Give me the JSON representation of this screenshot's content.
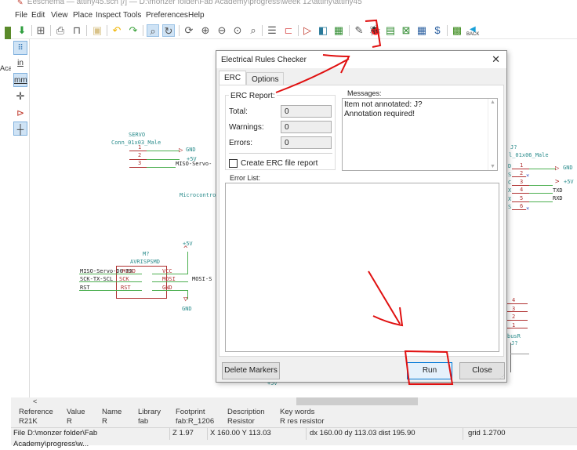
{
  "window": {
    "title": "Eeschema — attiny45.sch [/] — D:\\monzer folder\\Fab Academy\\progress\\week 12\\attiny\\attiny45"
  },
  "menu": [
    "File",
    "Edit",
    "View",
    "Place",
    "Inspect",
    "Tools",
    "Preferences",
    "Help"
  ],
  "toolbar": {
    "icons": [
      "save-icon",
      "page-settings-icon",
      "print-icon",
      "plot-icon",
      "paste-icon",
      "undo-icon",
      "redo-icon",
      "find-icon",
      "find-replace-icon",
      "redraw-icon",
      "zoom-in-icon",
      "zoom-out-icon",
      "zoom-fit-icon",
      "zoom-selection-icon",
      "hierarchy-navigator-icon",
      "leave-sheet-icon",
      "symbol-editor-icon",
      "symbol-browser-icon",
      "footprint-editor-icon",
      "annotate-icon",
      "erc-icon",
      "assign-footprints-icon",
      "netlist-icon",
      "bom-table-icon",
      "bom-icon",
      "pcbnew-icon",
      "back-icon"
    ],
    "back_label": "BACK"
  },
  "left_toolbar": {
    "items": [
      "grid-toggle",
      "units-inches",
      "units-mm",
      "cursor-shape",
      "hidden-pins",
      "wire-angle"
    ],
    "in_label": "in",
    "mm_label": "mm",
    "side_text": "Aca"
  },
  "schematic": {
    "servo": {
      "ref": "SERVO",
      "value": "Conn_01x03_Male",
      "pins": [
        "1",
        "2",
        "3"
      ],
      "nets": [
        "GND",
        "+5V",
        "MISO-Servo-"
      ]
    },
    "micro_label": "Microcontro",
    "isp": {
      "ref": "M?",
      "value": "AVRISPSMD",
      "left_pins": [
        "MISO",
        "SCK",
        "RST"
      ],
      "right_pins": [
        "VCC",
        "MOSI",
        "GND"
      ],
      "left_nets": [
        "MISO-Servo-D0-RX",
        "SCK-TX-SCL",
        "RST"
      ],
      "right_net": "MOSI-S",
      "power_top": "+5V",
      "power_bottom": "GND"
    },
    "ftdi": {
      "ref": "J?",
      "value": "l_01x06_Male",
      "pins": [
        "1",
        "2",
        "3",
        "4",
        "5",
        "6"
      ],
      "pin_names": [
        "D",
        "S",
        "C",
        "X",
        "X",
        "S"
      ],
      "nets": [
        "GND",
        "",
        "+5V",
        "TXD",
        "RXD",
        ""
      ]
    },
    "bus_r": {
      "pins": [
        "4",
        "3",
        "2",
        "1"
      ],
      "label": "busR",
      "ref": "J?"
    },
    "bottom_power": "+5V"
  },
  "dialog": {
    "title": "Electrical Rules Checker",
    "tabs": [
      "ERC",
      "Options"
    ],
    "active_tab": "ERC",
    "erc_report_label": "ERC Report:",
    "total_label": "Total:",
    "total_value": "0",
    "warnings_label": "Warnings:",
    "warnings_value": "0",
    "errors_label": "Errors:",
    "errors_value": "0",
    "create_report_label": "Create ERC file report",
    "create_report_checked": false,
    "messages_label": "Messages:",
    "messages": [
      "Item not annotated: J?",
      "Annotation required!"
    ],
    "error_list_label": "Error List:",
    "delete_markers_label": "Delete Markers",
    "run_label": "Run",
    "close_label": "Close"
  },
  "properties": {
    "headers": [
      "Reference",
      "Value",
      "Name",
      "Library",
      "Footprint",
      "Description",
      "Key words"
    ],
    "values": [
      "R21K",
      "R",
      "R",
      "fab",
      "fab:R_1206",
      "Resistor",
      "R res resistor"
    ]
  },
  "statusbar": {
    "file": "File D:\\monzer folder\\Fab Academy\\progress\\w...",
    "zoom": "Z 1.97",
    "xy": "X 160.00  Y 113.03",
    "delta": "dx 160.00  dy 113.03  dist 195.90",
    "grid": "grid 1.2700"
  },
  "colors": {
    "schematic_teal": "#2a8c8c",
    "pin_red": "#b03030",
    "wire_green": "#4caf50",
    "annotation_red": "#e01010",
    "button_focus": "#0078d7"
  }
}
